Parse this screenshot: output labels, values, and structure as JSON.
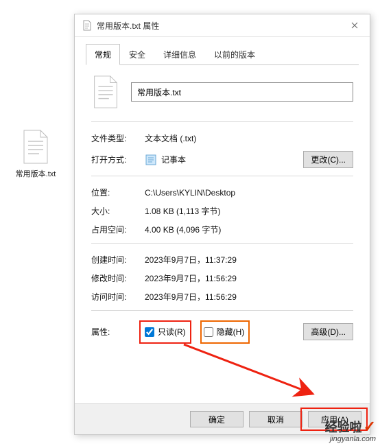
{
  "desktop_file": {
    "label": "常用版本.txt"
  },
  "window": {
    "title": "常用版本.txt 属性",
    "tabs": {
      "general": "常规",
      "security": "安全",
      "details": "详细信息",
      "previous": "以前的版本"
    },
    "filename_value": "常用版本.txt",
    "type": {
      "label": "文件类型:",
      "value": "文本文档 (.txt)"
    },
    "open_with": {
      "label": "打开方式:",
      "app": "记事本",
      "change_btn": "更改(C)..."
    },
    "location": {
      "label": "位置:",
      "value": "C:\\Users\\KYLIN\\Desktop"
    },
    "size": {
      "label": "大小:",
      "value": "1.08 KB (1,113 字节)"
    },
    "size_on_disk": {
      "label": "占用空间:",
      "value": "4.00 KB (4,096 字节)"
    },
    "created": {
      "label": "创建时间:",
      "value": "2023年9月7日，11:37:29"
    },
    "modified": {
      "label": "修改时间:",
      "value": "2023年9月7日，11:56:29"
    },
    "accessed": {
      "label": "访问时间:",
      "value": "2023年9月7日，11:56:29"
    },
    "attributes": {
      "label": "属性:",
      "readonly": "只读(R)",
      "hidden": "隐藏(H)",
      "advanced_btn": "高级(D)..."
    },
    "buttons": {
      "ok": "确定",
      "cancel": "取消",
      "apply": "应用(A)"
    }
  },
  "watermark": {
    "brand": "经验啦",
    "url": "jingyanla.com"
  }
}
